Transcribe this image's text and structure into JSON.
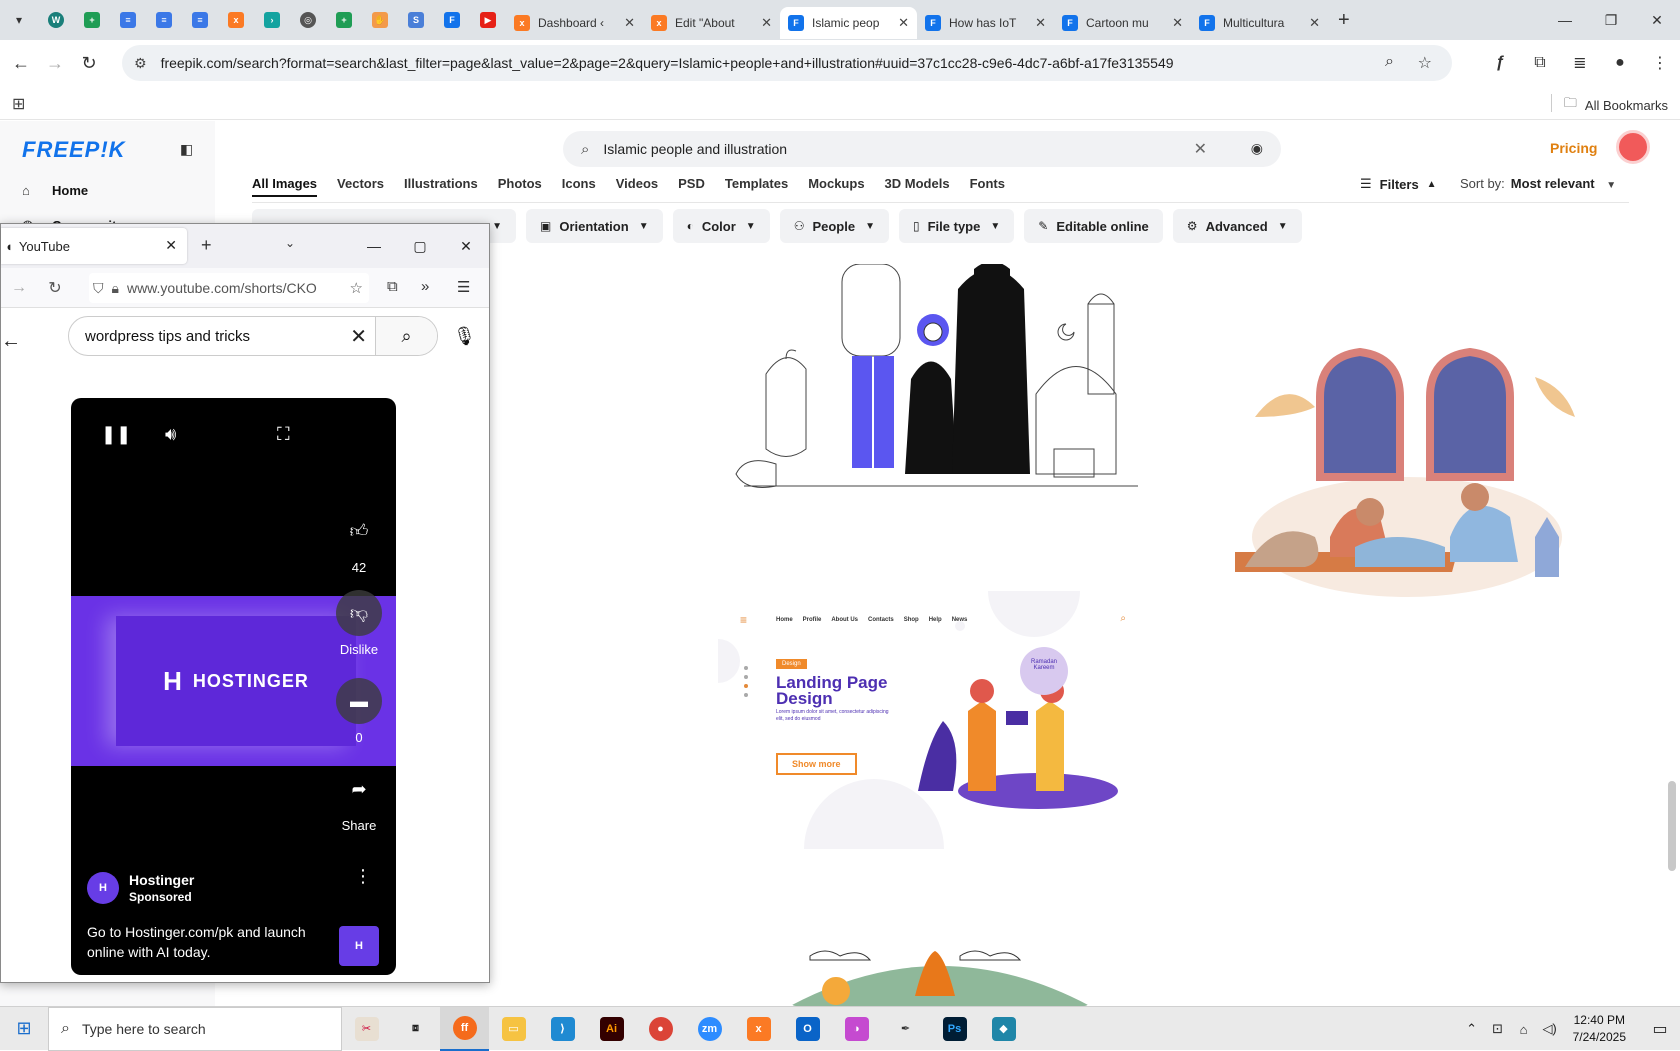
{
  "chrome": {
    "tabs": [
      {
        "label": "Dashboard ‹",
        "favicon": "xampp-icon",
        "color": "#fb7a24"
      },
      {
        "label": "Edit \"About",
        "favicon": "xampp-icon",
        "color": "#fb7a24"
      },
      {
        "label": "Islamic peop",
        "favicon": "freepik-icon",
        "color": "#1273eb"
      },
      {
        "label": "How has IoT",
        "favicon": "freepik-icon",
        "color": "#1273eb"
      },
      {
        "label": "Cartoon mu",
        "favicon": "freepik-icon",
        "color": "#1273eb"
      },
      {
        "label": "Multicultura",
        "favicon": "freepik-icon",
        "color": "#1273eb"
      }
    ],
    "url": "freepik.com/search?format=search&last_filter=page&last_value=2&page=2&query=Islamic+people+and+illustration#uuid=37c1cc28-c9e6-4dc7-a6bf-a17fe3135549",
    "all_bookmarks": "All Bookmarks"
  },
  "freepik": {
    "logo": "FREEP!K",
    "nav": {
      "home": "Home",
      "community": "Community"
    },
    "search_query": "Islamic people and illustration",
    "pricing": "Pricing",
    "categories": [
      "All Images",
      "Vectors",
      "Illustrations",
      "Photos",
      "Icons",
      "Videos",
      "PSD",
      "Templates",
      "Mockups",
      "3D Models",
      "Fonts"
    ],
    "filters_label": "Filters",
    "sort_label": "Sort by:",
    "sort_value": "Most relevant",
    "chips": [
      "Orientation",
      "Color",
      "People",
      "File type",
      "Editable online",
      "Advanced"
    ],
    "landing": {
      "nav": [
        "Home",
        "Profile",
        "About Us",
        "Contacts",
        "Shop",
        "Help",
        "News"
      ],
      "badge": "Design",
      "title_1": "Landing Page",
      "title_2": "Design",
      "subtitle": "Lorem ipsum dolor sit amet, consectetur adipiscing elit, sed do eiusmod",
      "button": "Show more",
      "bubble": "Ramadan Kareem"
    }
  },
  "firefox": {
    "tab_title": "YouTube",
    "url": "www.youtube.com/shorts/CKO",
    "yt_search": "wordpress tips and tricks",
    "banner_text": "HOSTINGER",
    "likes": "42",
    "dislike_label": "Dislike",
    "comments": "0",
    "share_label": "Share",
    "channel": "Hostinger",
    "sponsored": "Sponsored",
    "description": "Go to Hostinger.com/pk and launch online with AI today."
  },
  "taskbar": {
    "search_placeholder": "Type here to search",
    "time": "12:40 PM",
    "date": "7/24/2025"
  }
}
